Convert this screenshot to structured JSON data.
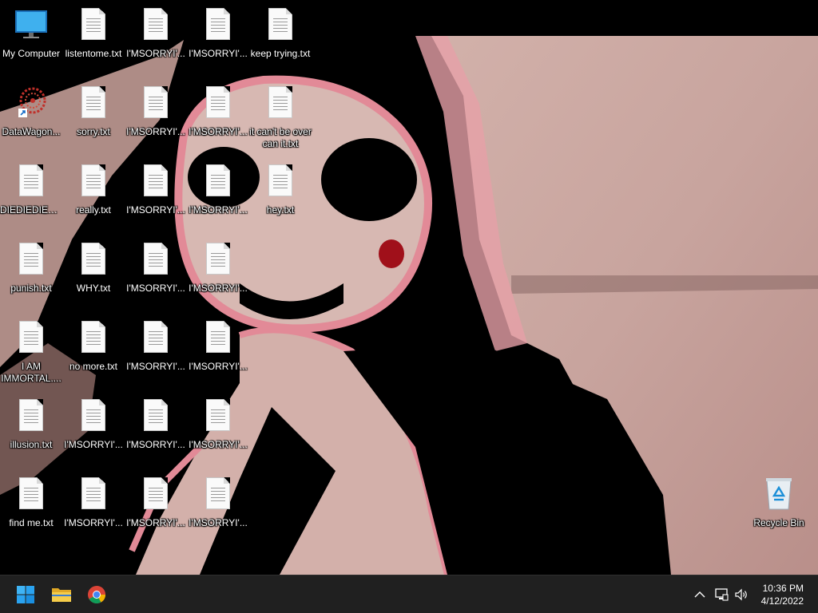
{
  "desktop": {
    "icons": [
      {
        "id": "my-computer",
        "label": "My Computer",
        "type": "computer"
      },
      {
        "id": "datawagon",
        "label": "DataWagon...",
        "type": "shortcut"
      },
      {
        "id": "diediedied",
        "label": "DIEDIEDIED...",
        "type": "txt"
      },
      {
        "id": "punish",
        "label": "punish.txt",
        "type": "txt"
      },
      {
        "id": "i-am-immortal",
        "label": "I AM IMMORTAL....",
        "type": "txt"
      },
      {
        "id": "illusion",
        "label": "illusion.txt",
        "type": "txt"
      },
      {
        "id": "find-me",
        "label": "find me.txt",
        "type": "txt"
      },
      {
        "id": "listentome",
        "label": "listentome.txt",
        "type": "txt"
      },
      {
        "id": "sorry",
        "label": "sorry.txt",
        "type": "txt"
      },
      {
        "id": "really",
        "label": "really.txt",
        "type": "txt"
      },
      {
        "id": "why",
        "label": "WHY.txt",
        "type": "txt"
      },
      {
        "id": "no-more",
        "label": "no more.txt",
        "type": "txt"
      },
      {
        "id": "imsorry-c2r6",
        "label": "I'MSORRYI'...",
        "type": "txt"
      },
      {
        "id": "imsorry-c2r7",
        "label": "I'MSORRYI'...",
        "type": "txt"
      },
      {
        "id": "imsorry-c3r1",
        "label": "I'MSORRYI'...",
        "type": "txt"
      },
      {
        "id": "imsorry-c3r2",
        "label": "I'MSORRYI'...",
        "type": "txt"
      },
      {
        "id": "imsorry-c3r3",
        "label": "I'MSORRYI'...",
        "type": "txt"
      },
      {
        "id": "imsorry-c3r4",
        "label": "I'MSORRYI'...",
        "type": "txt"
      },
      {
        "id": "imsorry-c3r5",
        "label": "I'MSORRYI'...",
        "type": "txt"
      },
      {
        "id": "imsorry-c3r6",
        "label": "I'MSORRYI'...",
        "type": "txt"
      },
      {
        "id": "imsorry-c3r7",
        "label": "I'MSORRYI'...",
        "type": "txt"
      },
      {
        "id": "imsorry-c4r1",
        "label": "I'MSORRYI'...",
        "type": "txt"
      },
      {
        "id": "imsorry-c4r2",
        "label": "I'MSORRYI'...",
        "type": "txt"
      },
      {
        "id": "imsorry-c4r3",
        "label": "I'MSORRYI'...",
        "type": "txt"
      },
      {
        "id": "imsorry-c4r4",
        "label": "I'MSORRYI'...",
        "type": "txt"
      },
      {
        "id": "imsorry-c4r5",
        "label": "I'MSORRYI'...",
        "type": "txt"
      },
      {
        "id": "imsorry-c4r6",
        "label": "I'MSORRYI'...",
        "type": "txt"
      },
      {
        "id": "imsorry-c4r7",
        "label": "I'MSORRYI'...",
        "type": "txt"
      },
      {
        "id": "keep-trying",
        "label": "keep trying.txt",
        "type": "txt"
      },
      {
        "id": "it-cant-be-over",
        "label": "it can't be over can it.txt",
        "type": "txt"
      },
      {
        "id": "hey",
        "label": "hey.txt",
        "type": "txt"
      },
      {
        "id": "recycle-bin",
        "label": "Recycle Bin",
        "type": "recycle"
      }
    ]
  },
  "taskbar": {
    "pinned": [
      {
        "name": "start",
        "icon": "windows-start-icon"
      },
      {
        "name": "file-explorer",
        "icon": "folder-icon"
      },
      {
        "name": "chrome",
        "icon": "chrome-icon"
      }
    ],
    "tray": {
      "icons": [
        "chevron-up-icon",
        "network-icon",
        "volume-icon"
      ],
      "time": "10:36 PM",
      "date": "4/12/2022"
    }
  },
  "colors": {
    "taskbar_bg": "#202020",
    "wallpaper_light": "#c9a9a3",
    "wallpaper_dark": "#000000",
    "wallpaper_pink": "#e6a0a8",
    "start_blue": "#2aa3f0"
  }
}
